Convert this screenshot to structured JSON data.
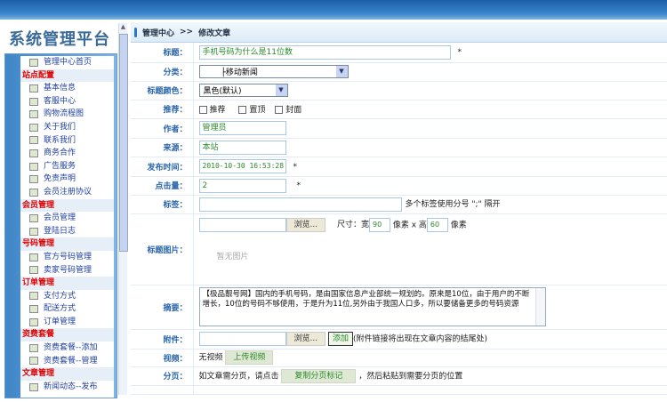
{
  "app": {
    "title": "系统管理平台"
  },
  "sidebar": {
    "items": [
      {
        "type": "item",
        "label": "管理中心首页"
      },
      {
        "type": "header",
        "label": "站点配置"
      },
      {
        "type": "item",
        "label": "基本信息"
      },
      {
        "type": "item",
        "label": "客服中心"
      },
      {
        "type": "item",
        "label": "购物流程图"
      },
      {
        "type": "item",
        "label": "关于我们"
      },
      {
        "type": "item",
        "label": "联系我们"
      },
      {
        "type": "item",
        "label": "商务合作"
      },
      {
        "type": "item",
        "label": "广告服务"
      },
      {
        "type": "item",
        "label": "免责声明"
      },
      {
        "type": "item",
        "label": "会员注册协议"
      },
      {
        "type": "header",
        "label": "会员管理"
      },
      {
        "type": "item",
        "label": "会员管理"
      },
      {
        "type": "item",
        "label": "登陆日志"
      },
      {
        "type": "header",
        "label": "号码管理"
      },
      {
        "type": "item",
        "label": "官方号码管理"
      },
      {
        "type": "item",
        "label": "卖家号码管理"
      },
      {
        "type": "header",
        "label": "订单管理"
      },
      {
        "type": "item",
        "label": "支付方式"
      },
      {
        "type": "item",
        "label": "配送方式"
      },
      {
        "type": "item",
        "label": "订单管理"
      },
      {
        "type": "header",
        "label": "资费套餐"
      },
      {
        "type": "item",
        "label": "资费套餐--添加"
      },
      {
        "type": "item",
        "label": "资费套餐--管理"
      },
      {
        "type": "header",
        "label": "文章管理"
      },
      {
        "type": "item",
        "label": "新闻动态--发布"
      }
    ]
  },
  "breadcrumb": {
    "home": "管理中心",
    "sep": ">>",
    "current": "修改文章"
  },
  "form": {
    "title": {
      "label": "标题：",
      "value": "手机号码为什么是11位数",
      "required": "*"
    },
    "category": {
      "label": "分类：",
      "value": "├移动新闻"
    },
    "title_color": {
      "label": "标题颜色：",
      "value": "黑色(默认)"
    },
    "recommend": {
      "label": "推荐：",
      "options": [
        "推荐",
        "置顶",
        "封面"
      ]
    },
    "author": {
      "label": "作者：",
      "value": "管理员"
    },
    "source": {
      "label": "来源：",
      "value": "本站"
    },
    "publish_time": {
      "label": "发布时间：",
      "value": "2010-10-30 16:53:28",
      "required": "*"
    },
    "hits": {
      "label": "点击量：",
      "value": "2",
      "required": "*"
    },
    "tags": {
      "label": "标签：",
      "value": "",
      "hint": "多个标签使用分号 \";\" 隔开"
    },
    "title_image": {
      "label": "标题图片：",
      "browse": "浏览...",
      "size_label": "尺寸：宽",
      "width": "90",
      "unit1": "像素 x 高",
      "height": "60",
      "unit2": "像素",
      "no_image": "暂无图片"
    },
    "summary": {
      "label": "摘要：",
      "value": "【极品靓号网】国内的手机号码，是由国家信息产业部统一规划的。原来是10位，由于用户的不断增长，10位的号码不够使用，于是升为11位,另外由于我国人口多，所以要储备更多的号码资源"
    },
    "attachment": {
      "label": "附件：",
      "browse": "浏览...",
      "add": "添加",
      "hint": "(附件链接将出现在文章内容的结尾处)"
    },
    "video": {
      "label": "视频：",
      "status": "无视频",
      "upload": "上传视频"
    },
    "paging": {
      "label": "分页：",
      "text1": "如文章需分页，请点击",
      "button": "复制分页标记",
      "text2": "，然后粘贴到需要分页的位置"
    }
  }
}
